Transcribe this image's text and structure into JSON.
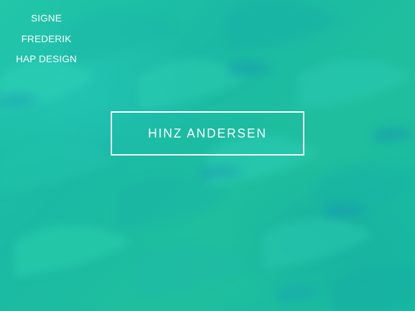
{
  "nav": {
    "items": [
      {
        "label": "SIGNE"
      },
      {
        "label": "FREDERIK"
      },
      {
        "label": "HAP DESIGN"
      }
    ]
  },
  "hero": {
    "title": "HINZ ANDERSEN"
  },
  "colors": {
    "background_primary": "#1fbf9e",
    "background_secondary": "#17b8a3",
    "foreground": "#ffffff"
  }
}
